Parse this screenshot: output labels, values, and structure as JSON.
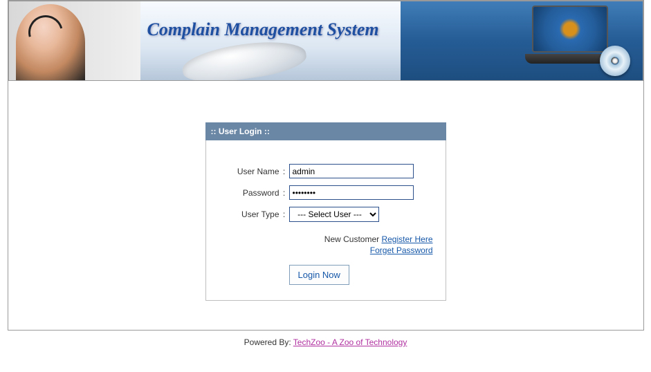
{
  "header": {
    "title": "Complain Management System"
  },
  "login": {
    "box_title": ":: User Login ::",
    "username_label": "User Name",
    "password_label": "Password",
    "usertype_label": "User Type",
    "username_value": "admin",
    "password_value": "••••••••",
    "usertype_selected": "--- Select User ---",
    "new_customer_text": "New Customer ",
    "register_link": "Register Here",
    "forget_link": "Forget Password",
    "button_label": "Login Now"
  },
  "footer": {
    "prefix": "Powered By: ",
    "link_text": "TechZoo - A Zoo of Technology"
  }
}
